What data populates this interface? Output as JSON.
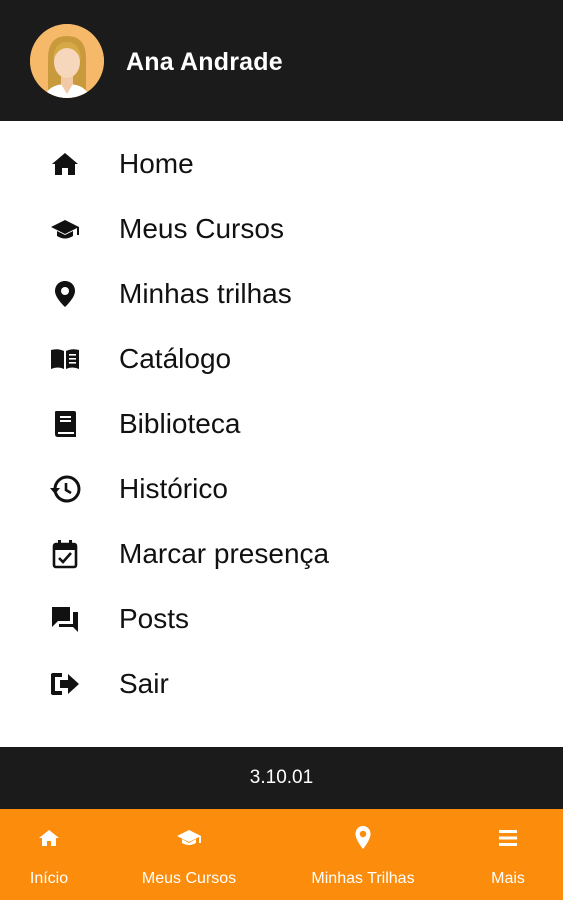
{
  "header": {
    "user_name": "Ana Andrade",
    "avatar_icon": "user-avatar-icon",
    "background_color": "#1b1b1b"
  },
  "menu": {
    "items": [
      {
        "label": "Home",
        "icon": "home-icon"
      },
      {
        "label": "Meus Cursos",
        "icon": "graduation-cap-icon"
      },
      {
        "label": "Minhas trilhas",
        "icon": "map-pin-icon"
      },
      {
        "label": "Catálogo",
        "icon": "open-book-icon"
      },
      {
        "label": "Biblioteca",
        "icon": "book-icon"
      },
      {
        "label": "Histórico",
        "icon": "history-icon"
      },
      {
        "label": "Marcar presença",
        "icon": "calendar-check-icon"
      },
      {
        "label": "Posts",
        "icon": "chat-bubbles-icon"
      },
      {
        "label": "Sair",
        "icon": "sign-out-icon"
      }
    ]
  },
  "version": {
    "text": "3.10.01"
  },
  "bottom_nav": {
    "accent_color": "#fb8c0c",
    "items": [
      {
        "label": "Início",
        "icon": "home-icon"
      },
      {
        "label": "Meus Cursos",
        "icon": "graduation-cap-icon"
      },
      {
        "label": "Minhas Trilhas",
        "icon": "map-pin-icon"
      },
      {
        "label": "Mais",
        "icon": "menu-icon"
      }
    ]
  }
}
